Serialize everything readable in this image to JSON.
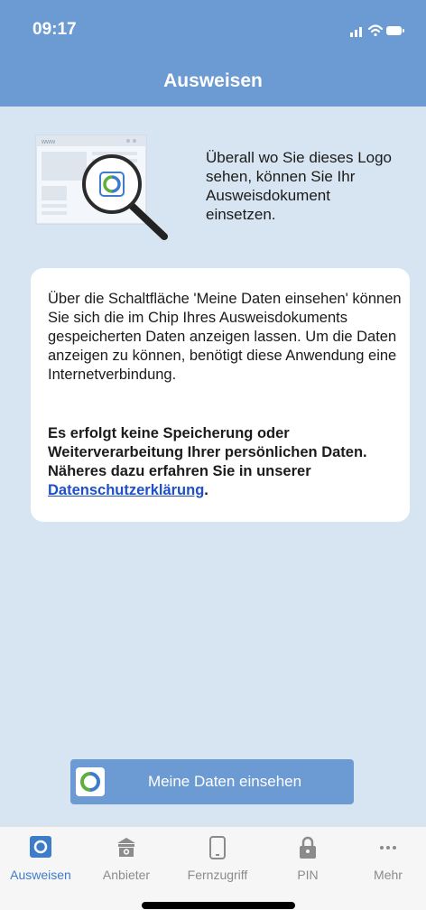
{
  "status_bar": {
    "time": "09:17"
  },
  "header": {
    "title": "Ausweisen"
  },
  "illustration": {
    "browser_text": "www"
  },
  "intro": {
    "text": "Überall wo Sie dieses Logo sehen, können Sie Ihr Ausweisdokument einsetzen."
  },
  "info_card": {
    "paragraph1": "Über die Schaltfläche 'Meine Daten einsehen' können Sie sich die im Chip Ihres Ausweisdokuments gespeicherten Daten anzeigen lassen. Um die Daten anzeigen zu können, benötigt diese Anwendung eine Internetverbindung.",
    "paragraph2": "Es erfolgt keine Speicherung oder Weiterverarbeitung Ihrer persönlichen Daten. Näheres dazu erfahren Sie in unserer ",
    "link": "Datenschutzerklärung",
    "paragraph2_end": "."
  },
  "action_button": {
    "label": "Meine Daten einsehen"
  },
  "tabbar": {
    "tabs": [
      {
        "label": "Ausweisen",
        "icon": "id-logo-icon",
        "active": true
      },
      {
        "label": "Anbieter",
        "icon": "bank-icon",
        "active": false
      },
      {
        "label": "Fernzugriff",
        "icon": "phone-icon",
        "active": false
      },
      {
        "label": "PIN",
        "icon": "lock-icon",
        "active": false
      },
      {
        "label": "Mehr",
        "icon": "more-dots-icon",
        "active": false
      }
    ]
  },
  "colors": {
    "header": "#6b9bd2",
    "background": "#d6e5f1",
    "active_tab": "#3d7cc9",
    "link": "#1f4fc8"
  }
}
